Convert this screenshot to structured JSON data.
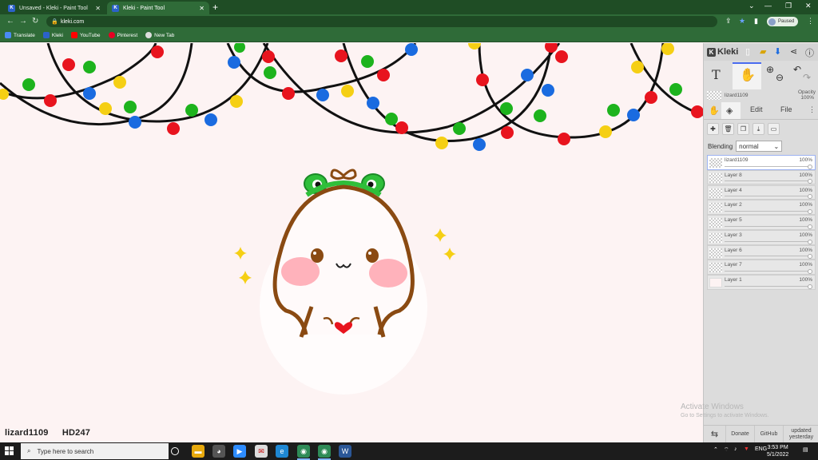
{
  "browser": {
    "tabs": [
      {
        "title": "Unsaved - Kleki - Paint Tool",
        "active": false
      },
      {
        "title": "Kleki - Paint Tool",
        "active": true
      }
    ],
    "url": "kleki.com",
    "profile_status": "Paused",
    "bookmarks": [
      {
        "label": "Translate",
        "color": "#4a8af4"
      },
      {
        "label": "Kleki",
        "color": "#2b62c9"
      },
      {
        "label": "YouTube",
        "color": "#ff0000"
      },
      {
        "label": "Pinterest",
        "color": "#e60023"
      },
      {
        "label": "New Tab",
        "color": "#dddddd"
      }
    ]
  },
  "canvas": {
    "caption_left": "lizard1109",
    "caption_right": "HD247",
    "background": "#fdf3f3"
  },
  "panel": {
    "logo": "Kleki",
    "current_layer_name": "lizard1109",
    "opacity_label": "Opacity",
    "opacity_value": "100%",
    "tabs": {
      "edit": "Edit",
      "file": "File"
    },
    "blending_label": "Blending",
    "blending_value": "normal",
    "layers": [
      {
        "name": "lizard1109",
        "opacity": "100%",
        "active": true
      },
      {
        "name": "Layer 8",
        "opacity": "100%",
        "active": false
      },
      {
        "name": "Layer 4",
        "opacity": "100%",
        "active": false
      },
      {
        "name": "Layer 2",
        "opacity": "100%",
        "active": false
      },
      {
        "name": "Layer 5",
        "opacity": "100%",
        "active": false
      },
      {
        "name": "Layer 3",
        "opacity": "100%",
        "active": false
      },
      {
        "name": "Layer 6",
        "opacity": "100%",
        "active": false
      },
      {
        "name": "Layer 7",
        "opacity": "100%",
        "active": false
      },
      {
        "name": "Layer 1",
        "opacity": "100%",
        "active": false
      }
    ],
    "footer": {
      "donate": "Donate",
      "github": "GitHub",
      "updated": "updated",
      "updated_when": "yesterday"
    }
  },
  "watermark": {
    "line1": "Activate Windows",
    "line2": "Go to Settings to activate Windows."
  },
  "taskbar": {
    "search_placeholder": "Type here to search",
    "language": "ENG",
    "time": "3:53 PM",
    "date": "5/1/2022"
  },
  "icons": {
    "accent_blue": "#4a6cf0",
    "light_colors": [
      "#e8141e",
      "#1db31d",
      "#1a6be0",
      "#f5cf14"
    ]
  }
}
